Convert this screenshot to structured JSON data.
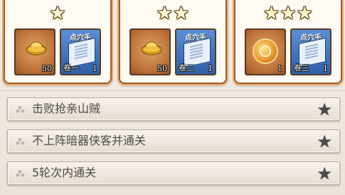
{
  "reward_cards": [
    {
      "stars": 1,
      "star_glyphs": [
        "★"
      ],
      "items": [
        {
          "icon": "gold-ingot-icon",
          "quantity": "50"
        },
        {
          "icon": "skill-book-icon",
          "banner": "点穴手",
          "volume": "卷一",
          "quantity": "1"
        }
      ]
    },
    {
      "stars": 2,
      "star_glyphs": [
        "★",
        "★"
      ],
      "items": [
        {
          "icon": "gold-ingot-icon",
          "quantity": "50"
        },
        {
          "icon": "skill-book-icon",
          "banner": "点穴手",
          "volume": "卷二",
          "quantity": "1"
        }
      ]
    },
    {
      "stars": 3,
      "star_glyphs": [
        "★",
        "★",
        "★"
      ],
      "items": [
        {
          "icon": "jade-token-icon",
          "quantity": "1"
        },
        {
          "icon": "skill-book-icon",
          "banner": "点穴手",
          "volume": "卷三",
          "quantity": "1"
        }
      ]
    }
  ],
  "objectives": [
    {
      "label": "击败抢亲山贼",
      "star": "★",
      "completed": false
    },
    {
      "label": "不上阵暗器侠客并通关",
      "star": "★",
      "completed": false
    },
    {
      "label": "5轮次内通关",
      "star": "★",
      "completed": false
    }
  ],
  "colors": {
    "card_border": "#a4582f",
    "card_glow": "#e5b06b",
    "star_fill": "#fff6c9",
    "objective_star": "#4a4a4a",
    "text": "#4e4a46"
  }
}
